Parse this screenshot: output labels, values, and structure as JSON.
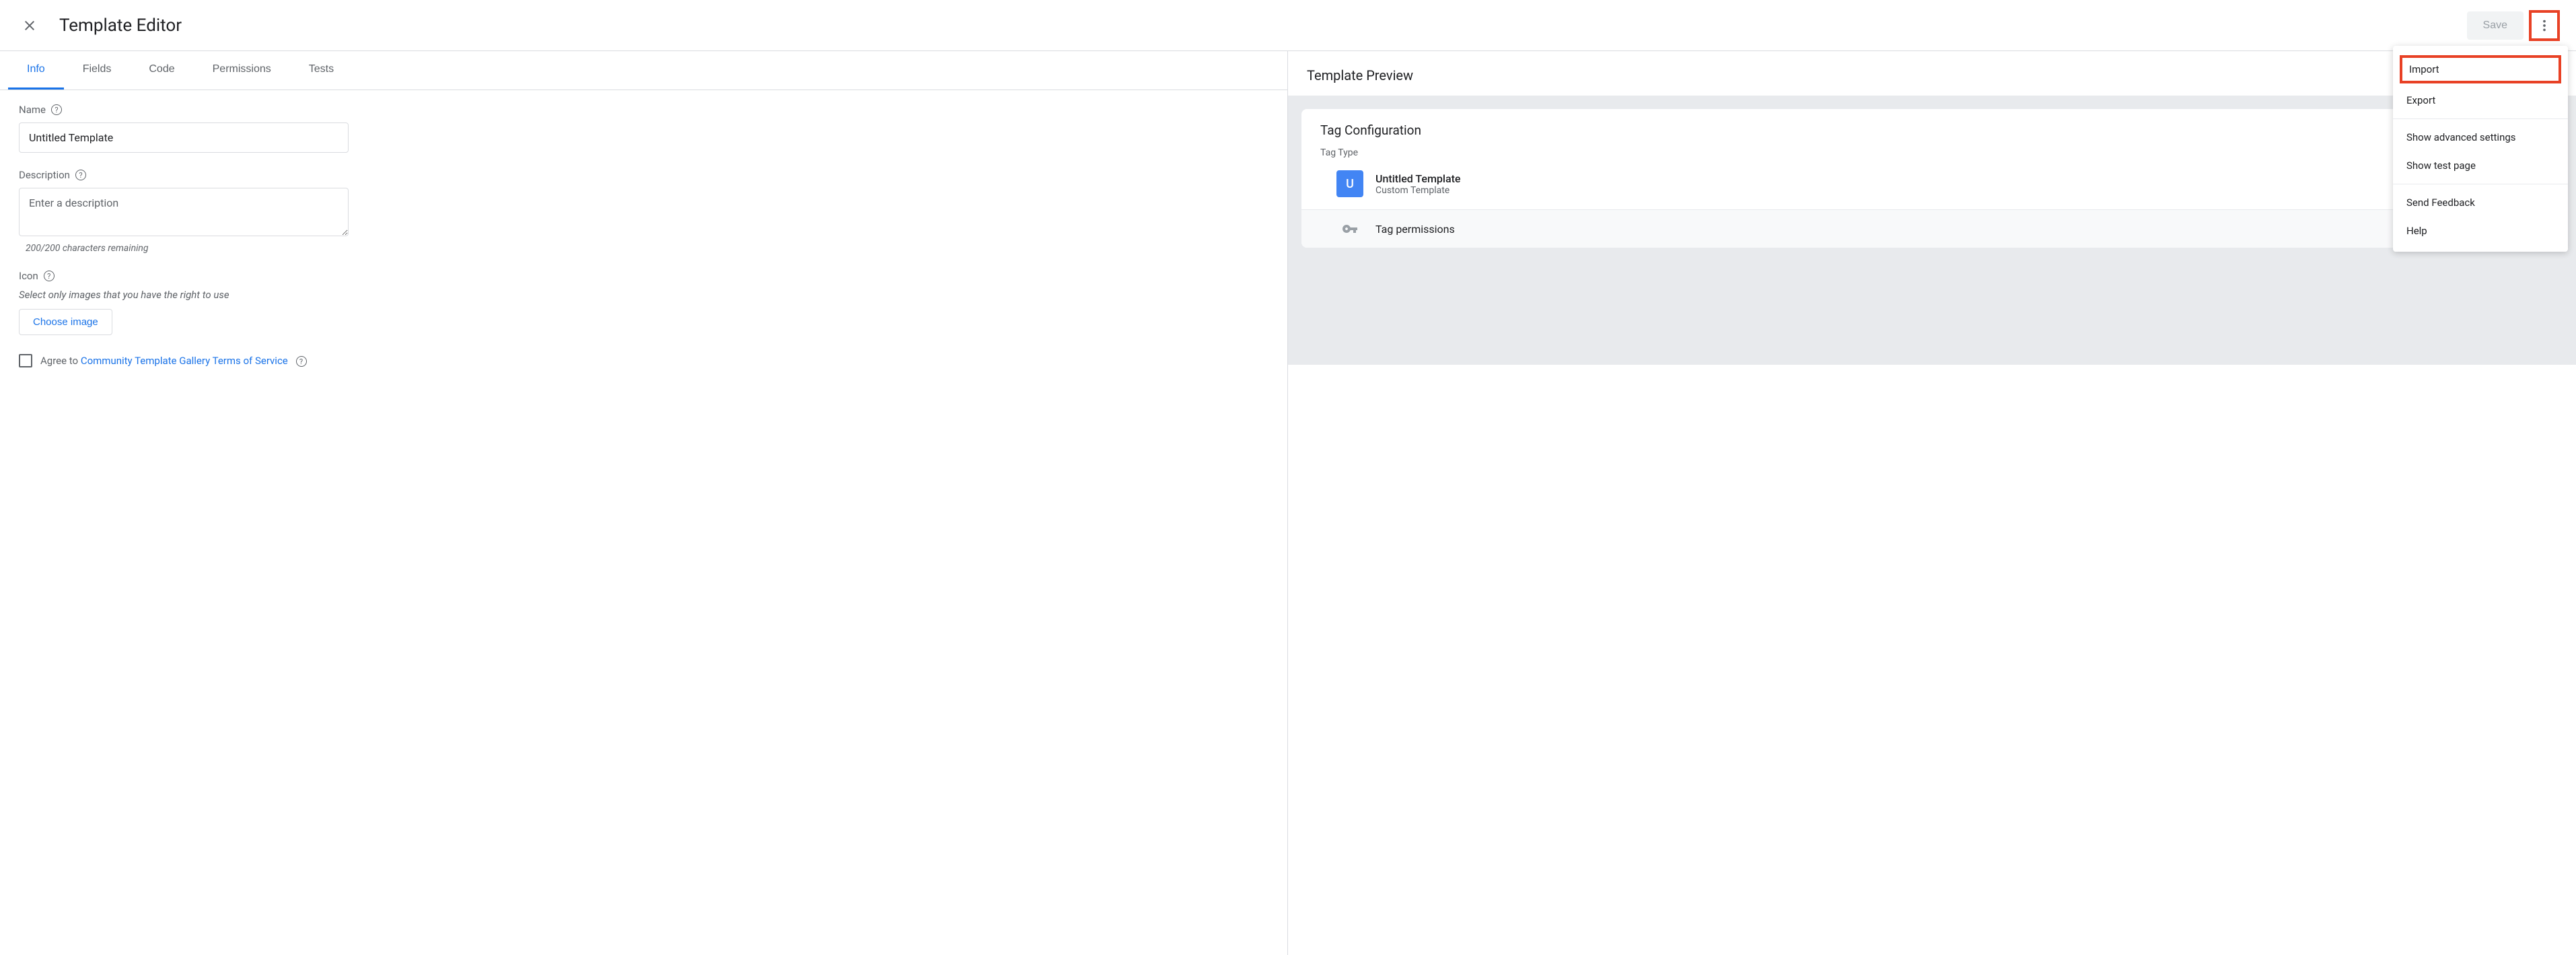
{
  "header": {
    "title": "Template Editor",
    "save_label": "Save"
  },
  "tabs": [
    {
      "label": "Info",
      "active": true
    },
    {
      "label": "Fields",
      "active": false
    },
    {
      "label": "Code",
      "active": false
    },
    {
      "label": "Permissions",
      "active": false
    },
    {
      "label": "Tests",
      "active": false
    }
  ],
  "info": {
    "name_label": "Name",
    "name_value": "Untitled Template",
    "description_label": "Description",
    "description_placeholder": "Enter a description",
    "char_remaining": "200/200 characters remaining",
    "icon_label": "Icon",
    "icon_hint": "Select only images that you have the right to use",
    "choose_image_label": "Choose image",
    "agree_prefix": "Agree to ",
    "agree_link": "Community Template Gallery Terms of Service"
  },
  "preview": {
    "title": "Template Preview",
    "config_title": "Tag Configuration",
    "tag_type_label": "Tag Type",
    "template_icon_letter": "U",
    "template_name": "Untitled Template",
    "template_subtitle": "Custom Template",
    "permissions_label": "Tag permissions"
  },
  "menu": {
    "import": "Import",
    "export": "Export",
    "advanced": "Show advanced settings",
    "test_page": "Show test page",
    "feedback": "Send Feedback",
    "help": "Help"
  }
}
